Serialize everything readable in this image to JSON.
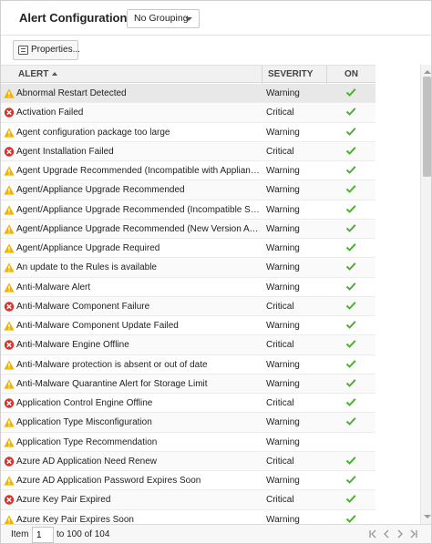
{
  "header": {
    "title": "Alert Configuration",
    "grouping": "No Grouping"
  },
  "toolbar": {
    "properties_label": "Properties..."
  },
  "columns": {
    "alert": "ALERT",
    "severity": "SEVERITY",
    "on": "ON"
  },
  "colors": {
    "warning": "#f0b400",
    "critical": "#d9322b",
    "check": "#4caf35"
  },
  "rows": [
    {
      "name": "Abnormal Restart Detected",
      "severity": "Warning",
      "on": true
    },
    {
      "name": "Activation Failed",
      "severity": "Critical",
      "on": true
    },
    {
      "name": "Agent configuration package too large",
      "severity": "Warning",
      "on": true
    },
    {
      "name": "Agent Installation Failed",
      "severity": "Critical",
      "on": true
    },
    {
      "name": "Agent Upgrade Recommended (Incompatible with Appliance)",
      "severity": "Warning",
      "on": true
    },
    {
      "name": "Agent/Appliance Upgrade Recommended",
      "severity": "Warning",
      "on": true
    },
    {
      "name": "Agent/Appliance Upgrade Recommended (Incompatible Security U...",
      "severity": "Warning",
      "on": true
    },
    {
      "name": "Agent/Appliance Upgrade Recommended (New Version Available)",
      "severity": "Warning",
      "on": true
    },
    {
      "name": "Agent/Appliance Upgrade Required",
      "severity": "Warning",
      "on": true
    },
    {
      "name": "An update to the Rules is available",
      "severity": "Warning",
      "on": true
    },
    {
      "name": "Anti-Malware Alert",
      "severity": "Warning",
      "on": true
    },
    {
      "name": "Anti-Malware Component Failure",
      "severity": "Critical",
      "on": true
    },
    {
      "name": "Anti-Malware Component Update Failed",
      "severity": "Warning",
      "on": true
    },
    {
      "name": "Anti-Malware Engine Offline",
      "severity": "Critical",
      "on": true
    },
    {
      "name": "Anti-Malware protection is absent or out of date",
      "severity": "Warning",
      "on": true
    },
    {
      "name": "Anti-Malware Quarantine Alert for Storage Limit",
      "severity": "Warning",
      "on": true
    },
    {
      "name": "Application Control Engine Offline",
      "severity": "Critical",
      "on": true
    },
    {
      "name": "Application Type Misconfiguration",
      "severity": "Warning",
      "on": true
    },
    {
      "name": "Application Type Recommendation",
      "severity": "Warning",
      "on": false
    },
    {
      "name": "Azure AD Application Need Renew",
      "severity": "Critical",
      "on": true
    },
    {
      "name": "Azure AD Application Password Expires Soon",
      "severity": "Warning",
      "on": true
    },
    {
      "name": "Azure Key Pair Expired",
      "severity": "Critical",
      "on": true
    },
    {
      "name": "Azure Key Pair Expires Soon",
      "severity": "Warning",
      "on": true
    }
  ],
  "footer": {
    "item_label": "Item",
    "item_value": "1",
    "range_text": "to 100 of 104"
  }
}
